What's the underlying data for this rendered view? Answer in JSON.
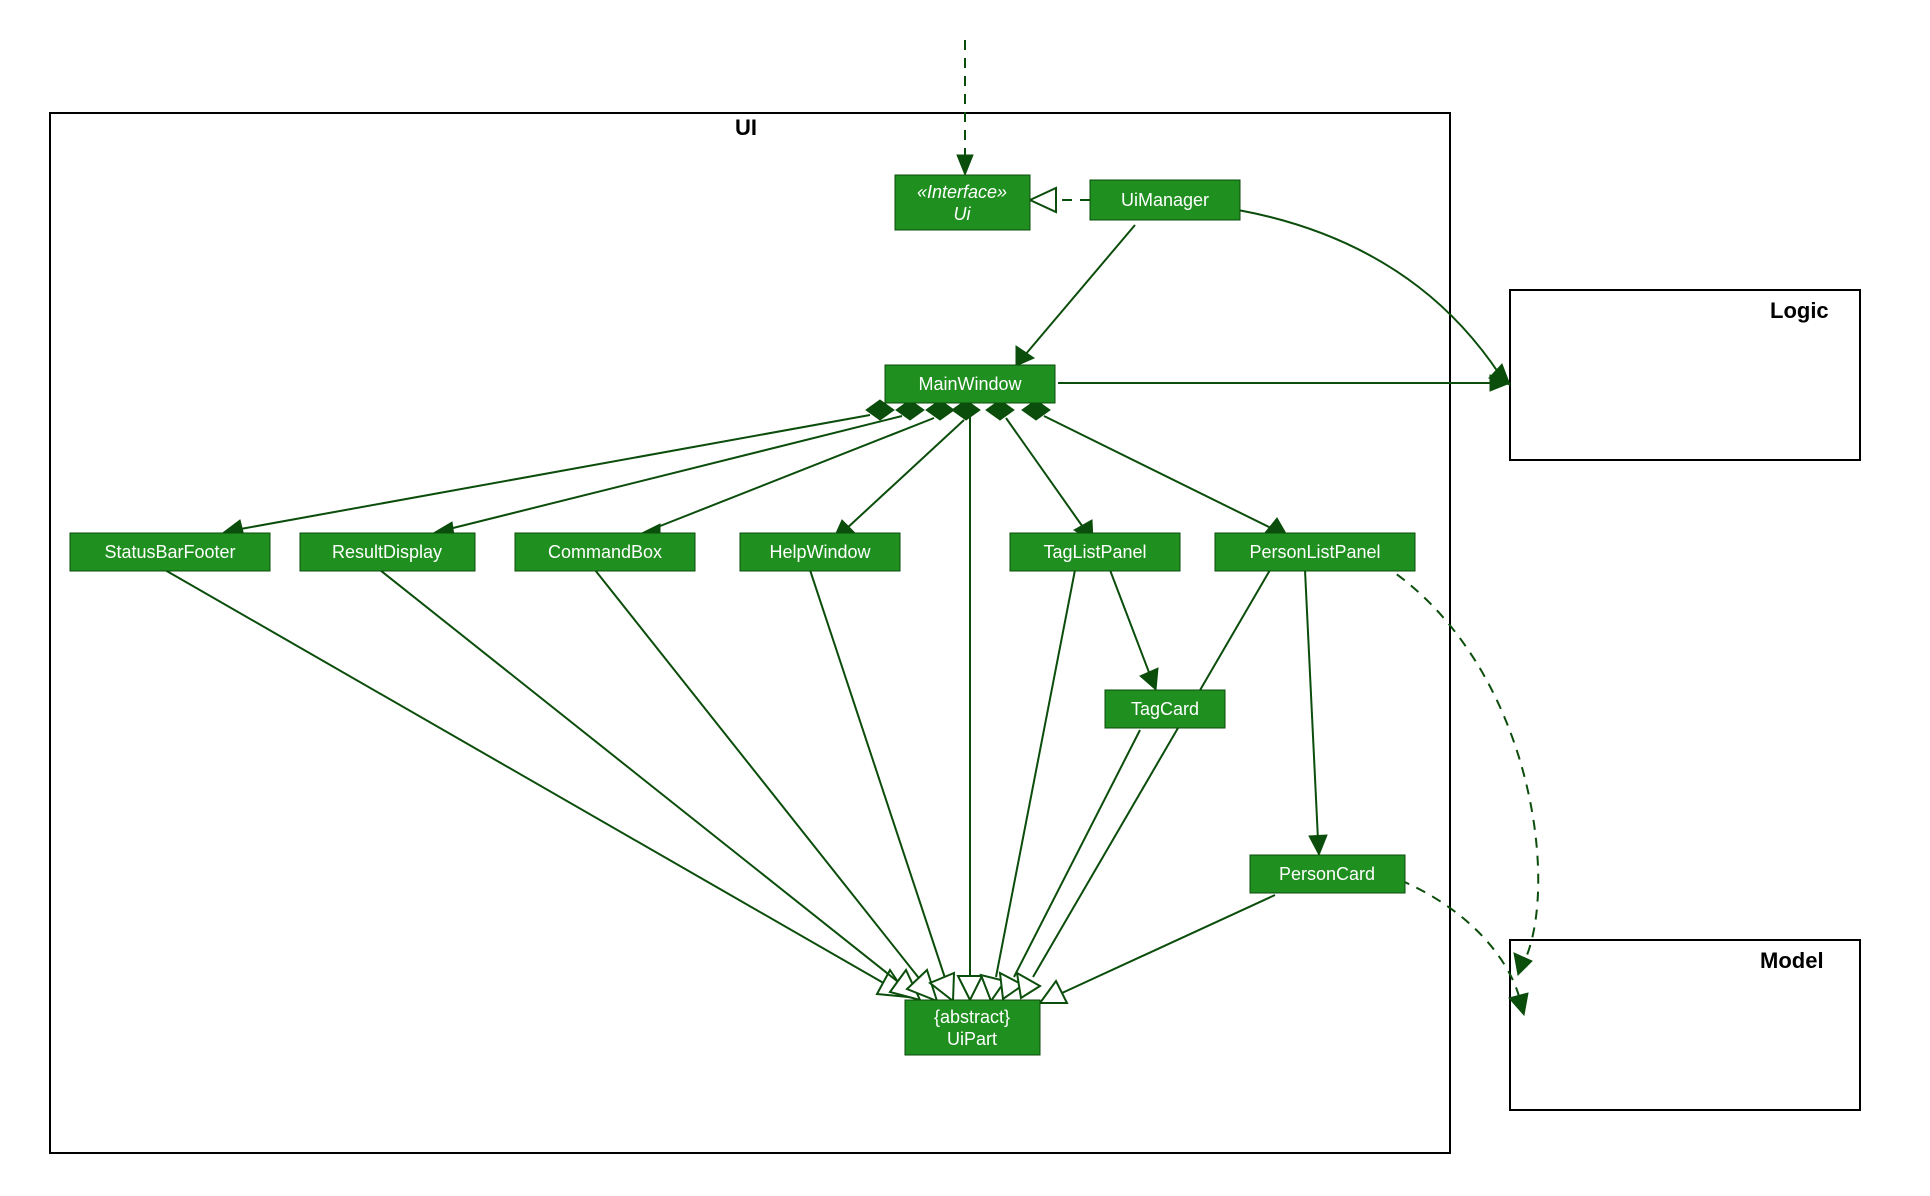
{
  "packages": {
    "ui": {
      "label": "UI"
    },
    "logic": {
      "label": "Logic"
    },
    "model": {
      "label": "Model"
    }
  },
  "nodes": {
    "uiInterface": {
      "stereotype": "«Interface»",
      "name": "Ui"
    },
    "uiManager": {
      "name": "UiManager"
    },
    "mainWindow": {
      "name": "MainWindow"
    },
    "statusBarFooter": {
      "name": "StatusBarFooter"
    },
    "resultDisplay": {
      "name": "ResultDisplay"
    },
    "commandBox": {
      "name": "CommandBox"
    },
    "helpWindow": {
      "name": "HelpWindow"
    },
    "tagListPanel": {
      "name": "TagListPanel"
    },
    "personListPanel": {
      "name": "PersonListPanel"
    },
    "tagCard": {
      "name": "TagCard"
    },
    "personCard": {
      "name": "PersonCard"
    },
    "uiPart": {
      "stereotype": "{abstract}",
      "name": "UiPart"
    }
  },
  "colors": {
    "node": "#1f8f1f",
    "edge": "#0b4d0b",
    "background": "#ffffff"
  }
}
